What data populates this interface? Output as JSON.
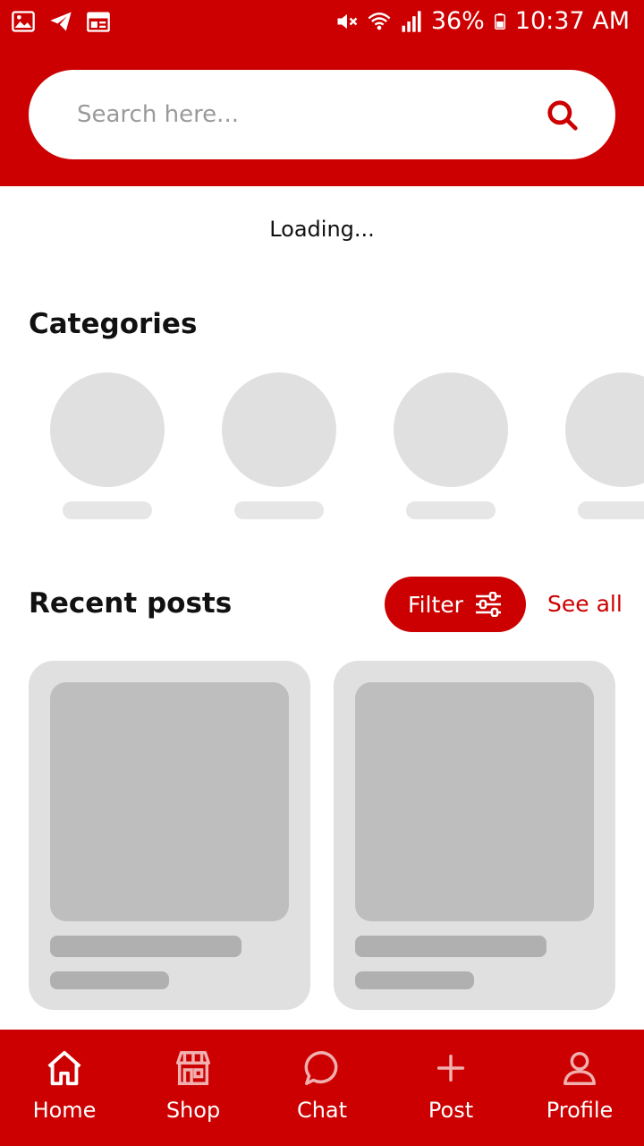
{
  "status_bar": {
    "battery": "36%",
    "time": "10:37 AM"
  },
  "search": {
    "placeholder": "Search here..."
  },
  "loading_text": "Loading...",
  "categories": {
    "title": "Categories"
  },
  "recent": {
    "title": "Recent posts",
    "filter_label": "Filter",
    "see_all_label": "See all"
  },
  "bottom_nav": {
    "items": [
      {
        "label": "Home",
        "icon": "home-icon",
        "active": true
      },
      {
        "label": "Shop",
        "icon": "shop-icon",
        "active": false
      },
      {
        "label": "Chat",
        "icon": "chat-icon",
        "active": false
      },
      {
        "label": "Post",
        "icon": "plus-icon",
        "active": false
      },
      {
        "label": "Profile",
        "icon": "profile-icon",
        "active": false
      }
    ]
  },
  "colors": {
    "accent": "#cc0000",
    "skeleton_light": "#e0e0e0",
    "skeleton_dark": "#bebebe"
  }
}
